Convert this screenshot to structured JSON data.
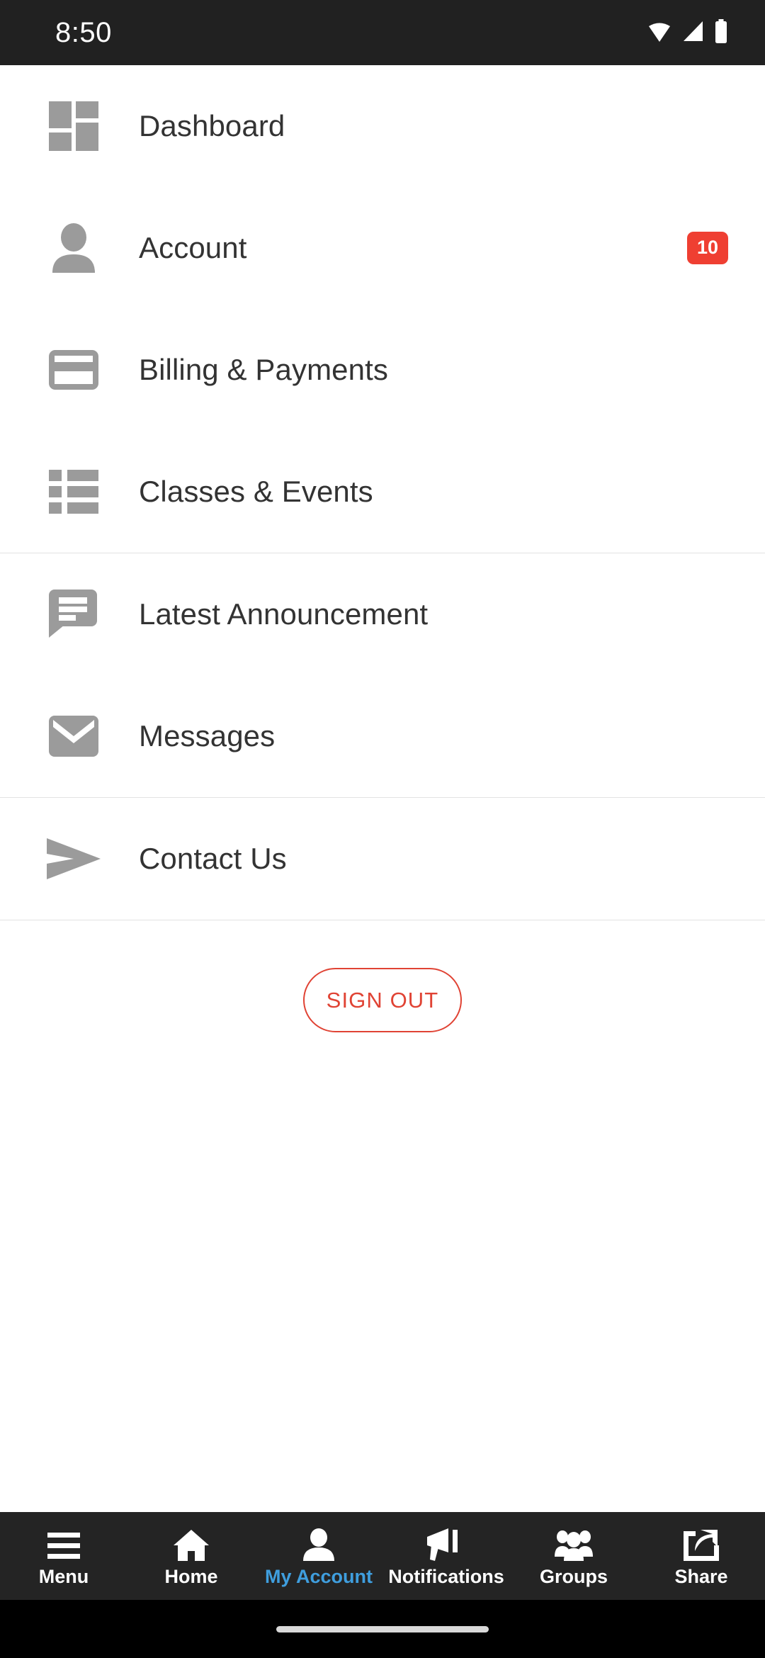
{
  "status_bar": {
    "time": "8:50",
    "icons": [
      "wifi-icon",
      "cell-signal-icon",
      "battery-icon"
    ]
  },
  "colors": {
    "badge_red": "#ef3f32",
    "signout_red": "#e04334",
    "icon_gray": "#9b9b9b",
    "label_dark": "#333333",
    "nav_bg": "#242424",
    "nav_active_blue": "#3f9ede",
    "status_bg": "#212121"
  },
  "menu": {
    "groups": [
      {
        "items": [
          {
            "id": "dashboard",
            "label": "Dashboard",
            "icon": "dashboard-grid-icon",
            "badge": null
          },
          {
            "id": "account",
            "label": "Account",
            "icon": "person-icon",
            "badge": "10"
          },
          {
            "id": "billing-payments",
            "label": "Billing & Payments",
            "icon": "credit-card-icon",
            "badge": null
          },
          {
            "id": "classes-events",
            "label": "Classes & Events",
            "icon": "list-icon",
            "badge": null
          }
        ]
      },
      {
        "items": [
          {
            "id": "latest-announcement",
            "label": "Latest Announcement",
            "icon": "speech-bubble-icon",
            "badge": null
          },
          {
            "id": "messages",
            "label": "Messages",
            "icon": "envelope-icon",
            "badge": null
          }
        ]
      },
      {
        "items": [
          {
            "id": "contact-us",
            "label": "Contact Us",
            "icon": "send-arrow-icon",
            "badge": null
          }
        ]
      }
    ]
  },
  "signout": {
    "label": "SIGN OUT"
  },
  "bottom_nav": {
    "items": [
      {
        "id": "menu",
        "label": "Menu",
        "icon": "hamburger-icon",
        "active": false
      },
      {
        "id": "home",
        "label": "Home",
        "icon": "house-icon",
        "active": false
      },
      {
        "id": "my-account",
        "label": "My Account",
        "icon": "person-icon",
        "active": true
      },
      {
        "id": "notifications",
        "label": "Notifications",
        "icon": "megaphone-icon",
        "active": false
      },
      {
        "id": "groups",
        "label": "Groups",
        "icon": "people-group-icon",
        "active": false
      },
      {
        "id": "share",
        "label": "Share",
        "icon": "share-box-arrow-icon",
        "active": false
      }
    ]
  }
}
